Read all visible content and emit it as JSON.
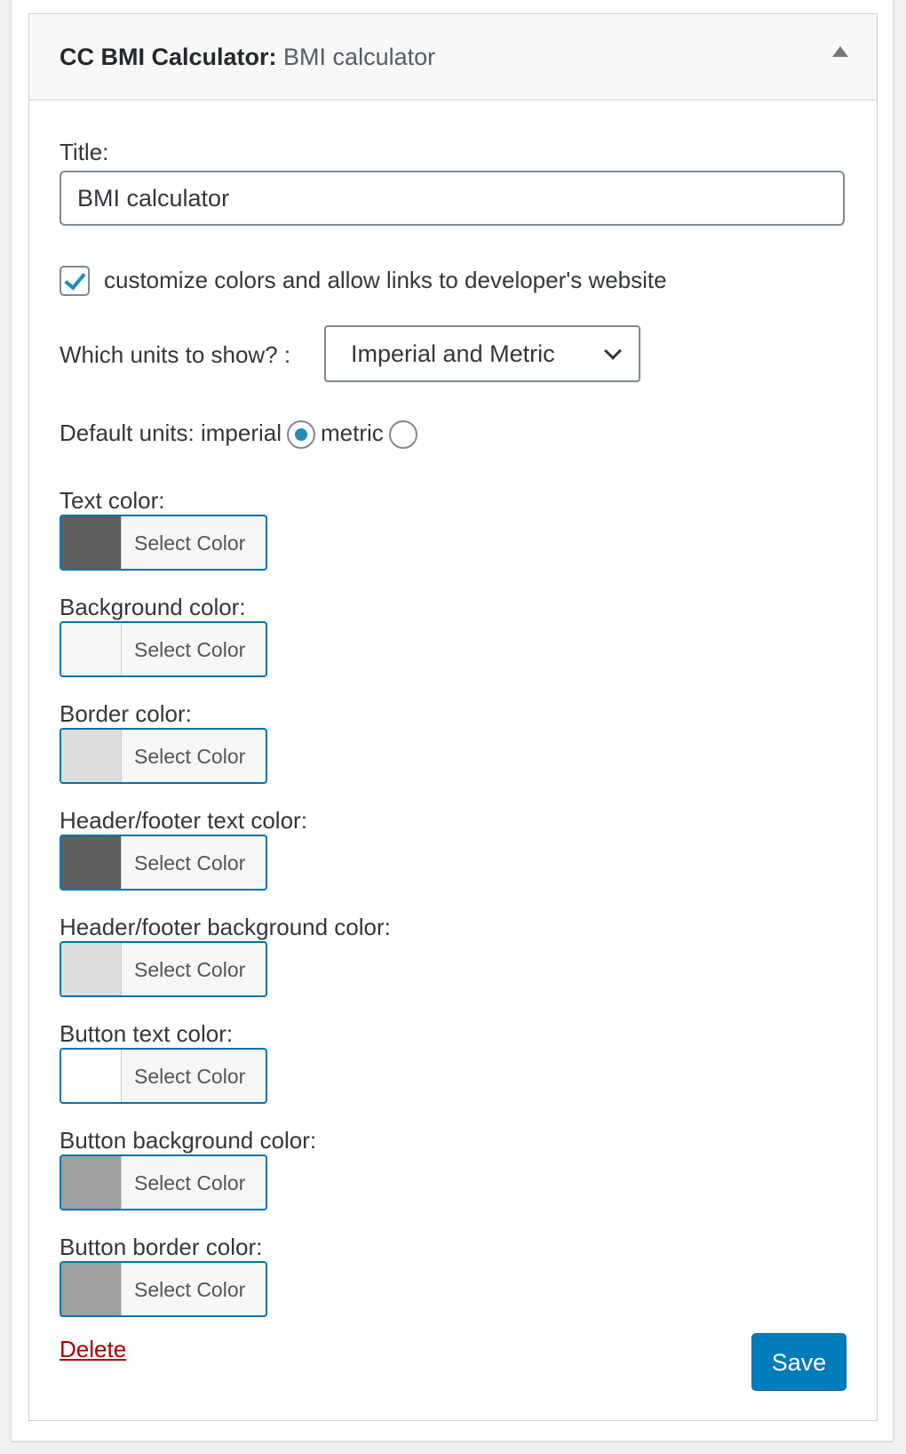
{
  "header": {
    "widget_name": "CC BMI Calculator:",
    "widget_title": "BMI calculator"
  },
  "form": {
    "title_label": "Title:",
    "title_value": "BMI calculator",
    "customize_label": "customize colors and allow links to developer's website",
    "customize_checked": true,
    "units_label": "Which units to show? :",
    "units_selected": "Imperial and Metric",
    "default_units_label": "Default units: imperial",
    "metric_label": "metric",
    "default_units_value": "imperial"
  },
  "colors": [
    {
      "label": "Text color:",
      "button": "Select Color",
      "swatch": "#5f5f5f"
    },
    {
      "label": "Background color:",
      "button": "Select Color",
      "swatch": "#f7f7f7"
    },
    {
      "label": "Border color:",
      "button": "Select Color",
      "swatch": "#dddddd"
    },
    {
      "label": "Header/footer text color:",
      "button": "Select Color",
      "swatch": "#5f5f5f"
    },
    {
      "label": "Header/footer background color:",
      "button": "Select Color",
      "swatch": "#dddddd"
    },
    {
      "label": "Button text color:",
      "button": "Select Color",
      "swatch": "#ffffff"
    },
    {
      "label": "Button background color:",
      "button": "Select Color",
      "swatch": "#a0a0a0"
    },
    {
      "label": "Button border color:",
      "button": "Select Color",
      "swatch": "#a0a0a0"
    }
  ],
  "actions": {
    "delete": "Delete",
    "save": "Save"
  }
}
